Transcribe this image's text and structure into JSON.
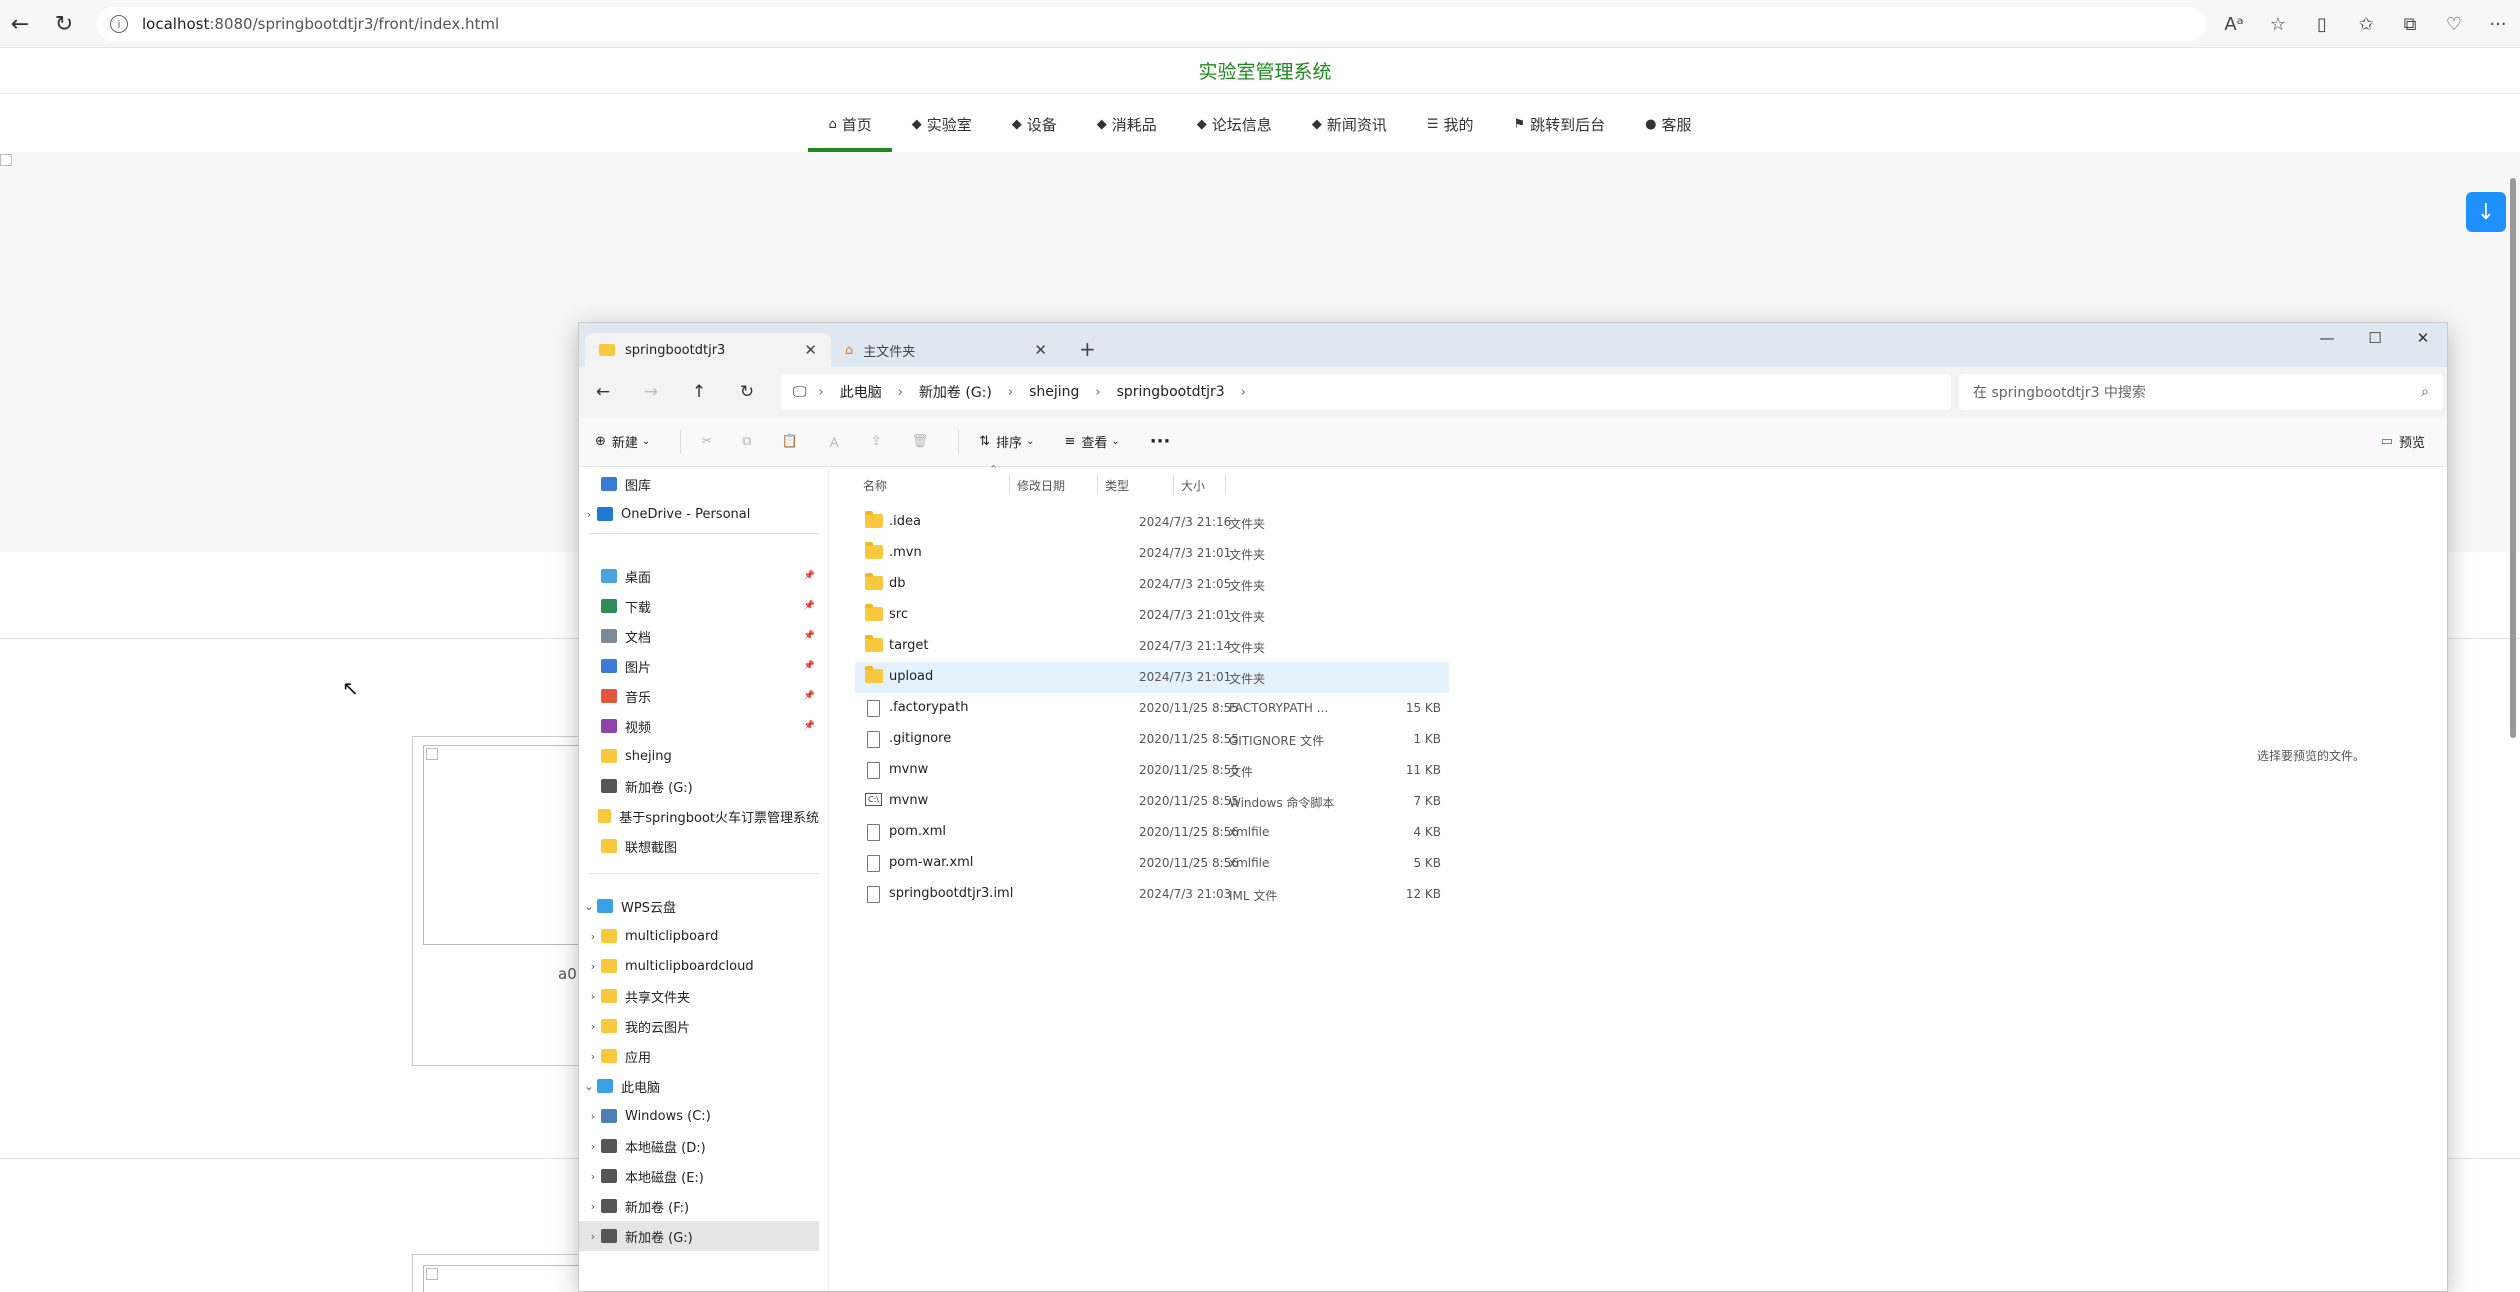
{
  "browser": {
    "url_host": "localhost",
    "url_rest": ":8080/springbootdtjr3/front/index.html",
    "back_icon": "back-arrow-icon",
    "reload_icon": "reload-icon"
  },
  "site": {
    "title": "实验室管理系统",
    "nav": [
      {
        "label": "首页",
        "icon": "home-icon",
        "glyph": "⌂",
        "active": true
      },
      {
        "label": "实验室",
        "icon": "cube-icon",
        "glyph": "◆"
      },
      {
        "label": "设备",
        "icon": "cube-icon",
        "glyph": "◆"
      },
      {
        "label": "消耗品",
        "icon": "cube-icon",
        "glyph": "◆"
      },
      {
        "label": "论坛信息",
        "icon": "cube-icon",
        "glyph": "◆"
      },
      {
        "label": "新闻资讯",
        "icon": "cube-icon",
        "glyph": "◆"
      },
      {
        "label": "我的",
        "icon": "menu-icon",
        "glyph": "☰"
      },
      {
        "label": "跳转到后台",
        "icon": "flag-icon",
        "glyph": "⚑"
      },
      {
        "label": "客服",
        "icon": "chat-icon",
        "glyph": "●"
      }
    ],
    "card_label": "a0"
  },
  "explorer": {
    "tabs": [
      {
        "label": "springbootdtjr3"
      },
      {
        "label": "主文件夹"
      }
    ],
    "breadcrumb": [
      "此电脑",
      "新加卷 (G:)",
      "shejing",
      "springbootdtjr3"
    ],
    "search_placeholder": "在 springbootdtjr3 中搜索",
    "commands": {
      "new": "新建",
      "sort": "排序",
      "view": "查看",
      "more": "···",
      "preview": "预览"
    },
    "nav_items": [
      {
        "label": "图库",
        "color": "#3a7bd5"
      },
      {
        "label": "OneDrive - Personal",
        "color": "#1f78d1",
        "chev": true
      },
      {
        "label": "桌面",
        "color": "#4aa3df",
        "pin": true
      },
      {
        "label": "下载",
        "color": "#2e8b57",
        "pin": true
      },
      {
        "label": "文档",
        "color": "#7a8a99",
        "pin": true
      },
      {
        "label": "图片",
        "color": "#3a7bd5",
        "pin": true
      },
      {
        "label": "音乐",
        "color": "#e0573b",
        "pin": true
      },
      {
        "label": "视频",
        "color": "#8e44ad",
        "pin": true
      },
      {
        "label": "shejing",
        "color": "#f8c93f"
      },
      {
        "label": "新加卷 (G:)",
        "color": "#555555"
      },
      {
        "label": "基于springboot火车订票管理系统",
        "color": "#f8c93f"
      },
      {
        "label": "联想截图",
        "color": "#f8c93f"
      },
      {
        "label": "WPS云盘",
        "color": "#3aa0e8",
        "chev": true
      },
      {
        "label": "multiclipboard",
        "color": "#f8c93f",
        "chev": true
      },
      {
        "label": "multiclipboardcloud",
        "color": "#f8c93f",
        "chev": true
      },
      {
        "label": "共享文件夹",
        "color": "#f8c93f",
        "chev": true
      },
      {
        "label": "我的云图片",
        "color": "#f8c93f",
        "chev": true
      },
      {
        "label": "应用",
        "color": "#f8c93f",
        "chev": true
      },
      {
        "label": "此电脑",
        "color": "#3aa0e8",
        "chev": true
      },
      {
        "label": "Windows (C:)",
        "color": "#4d7fb8",
        "chev": true
      },
      {
        "label": "本地磁盘 (D:)",
        "color": "#555555",
        "chev": true
      },
      {
        "label": "本地磁盘 (E:)",
        "color": "#555555",
        "chev": true
      },
      {
        "label": "新加卷 (F:)",
        "color": "#555555",
        "chev": true
      },
      {
        "label": "新加卷 (G:)",
        "color": "#555555",
        "chev": true,
        "selected": true
      }
    ],
    "columns": {
      "name": "名称",
      "date": "修改日期",
      "type": "类型",
      "size": "大小"
    },
    "files": [
      {
        "name": ".idea",
        "date": "2024/7/3 21:16",
        "type": "文件夹",
        "size": "",
        "kind": "folder"
      },
      {
        "name": ".mvn",
        "date": "2024/7/3 21:01",
        "type": "文件夹",
        "size": "",
        "kind": "folder"
      },
      {
        "name": "db",
        "date": "2024/7/3 21:05",
        "type": "文件夹",
        "size": "",
        "kind": "folder"
      },
      {
        "name": "src",
        "date": "2024/7/3 21:01",
        "type": "文件夹",
        "size": "",
        "kind": "folder"
      },
      {
        "name": "target",
        "date": "2024/7/3 21:14",
        "type": "文件夹",
        "size": "",
        "kind": "folder"
      },
      {
        "name": "upload",
        "date": "2024/7/3 21:01",
        "type": "文件夹",
        "size": "",
        "kind": "folder",
        "hover": true
      },
      {
        "name": ".factorypath",
        "date": "2020/11/25 8:55",
        "type": "FACTORYPATH ...",
        "size": "15 KB",
        "kind": "file"
      },
      {
        "name": ".gitignore",
        "date": "2020/11/25 8:55",
        "type": "GITIGNORE 文件",
        "size": "1 KB",
        "kind": "file"
      },
      {
        "name": "mvnw",
        "date": "2020/11/25 8:55",
        "type": "文件",
        "size": "11 KB",
        "kind": "file"
      },
      {
        "name": "mvnw",
        "date": "2020/11/25 8:55",
        "type": "Windows 命令脚本",
        "size": "7 KB",
        "kind": "cmd"
      },
      {
        "name": "pom.xml",
        "date": "2020/11/25 8:56",
        "type": "xmlfile",
        "size": "4 KB",
        "kind": "file"
      },
      {
        "name": "pom-war.xml",
        "date": "2020/11/25 8:56",
        "type": "xmlfile",
        "size": "5 KB",
        "kind": "file"
      },
      {
        "name": "springbootdtjr3.iml",
        "date": "2024/7/3 21:03",
        "type": "IML 文件",
        "size": "12 KB",
        "kind": "file"
      }
    ],
    "preview_message": "选择要预览的文件。"
  }
}
